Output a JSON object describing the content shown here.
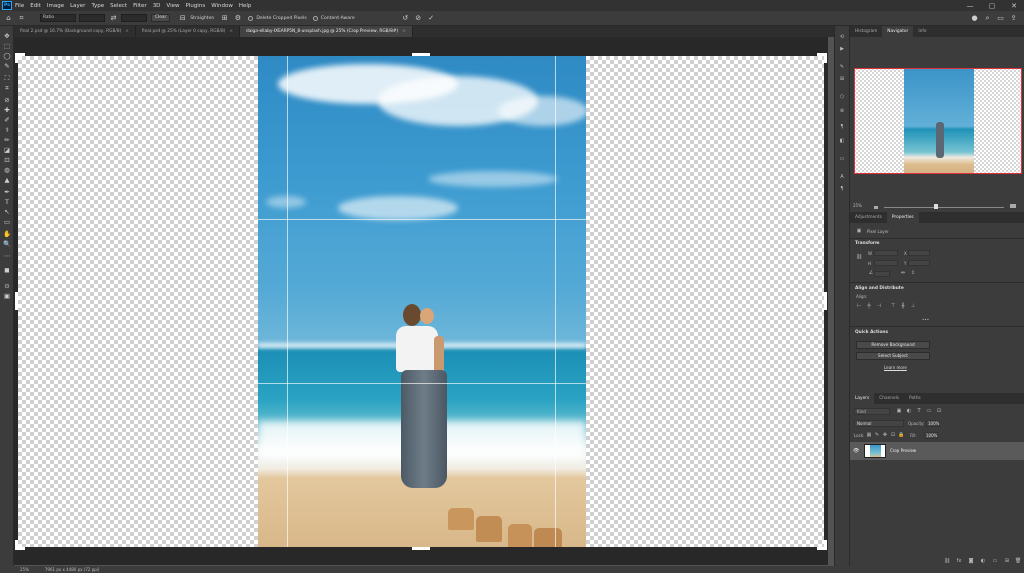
{
  "app": {
    "logo": "Ps"
  },
  "menu": [
    "File",
    "Edit",
    "Image",
    "Layer",
    "Type",
    "Select",
    "Filter",
    "3D",
    "View",
    "Plugins",
    "Window",
    "Help"
  ],
  "window_controls": {
    "minimize": "—",
    "maximize": "▢",
    "close": "✕"
  },
  "options_bar": {
    "ratio": "Ratio",
    "clear": "Clear",
    "straighten": "Straighten",
    "delete_cropped": "Delete Cropped Pixels",
    "content_aware": "Content-Aware",
    "cancel_glyph": "⊘",
    "commit_glyph": "✓",
    "reset_glyph": "↺"
  },
  "doc_tabs": [
    {
      "label": "final 2.psd @ 16.7% (Background copy, RGB/8)",
      "active": false
    },
    {
      "label": "final.psd @ 25% (Layer 0 copy, RGB/8)",
      "active": false
    },
    {
      "label": "daiga-ellaby-IXEARP5N_8-unsplash.jpg @ 25% (Crop Preview, RGB/8#)",
      "active": true
    }
  ],
  "tab_close": "×",
  "tools": [
    "✥",
    "⬚",
    "◯",
    "✎",
    "⛶",
    "⌗",
    "⊘",
    "✚",
    "✐",
    "⚕",
    "✏",
    "◪",
    "⊡",
    "◍",
    "▲",
    "✒",
    "T",
    "↖",
    "▭",
    "✋",
    "🔍",
    "⋯",
    "◼",
    "⊙",
    "▣"
  ],
  "status_bar": {
    "zoom": "25%",
    "doc_info": "7961 px x 4480 px (72 ppi)"
  },
  "navigator": {
    "tabs": [
      "Histogram",
      "Navigator",
      "Info"
    ],
    "active_tab": "Navigator",
    "zoom": "25%"
  },
  "properties": {
    "tabs": [
      "Adjustments",
      "Properties"
    ],
    "active_tab": "Properties",
    "pixel_layer": "Pixel Layer",
    "transform_title": "Transform",
    "w_label": "W",
    "h_label": "H",
    "x_label": "X",
    "y_label": "Y",
    "align_title": "Align and Distribute",
    "align_label": "Align:",
    "more": "•••",
    "quick_actions_title": "Quick Actions",
    "remove_background": "Remove Background",
    "select_subject": "Select Subject",
    "learn_more": "Learn more"
  },
  "layers": {
    "tabs": [
      "Layers",
      "Channels",
      "Paths"
    ],
    "active_tab": "Layers",
    "kind_label": "Kind",
    "blend_mode": "Normal",
    "opacity_label": "Opacity:",
    "opacity_value": "100%",
    "lock_label": "Lock:",
    "fill_label": "Fill:",
    "fill_value": "100%",
    "items": [
      {
        "name": "Crop Preview",
        "visible": true,
        "selected": true
      }
    ]
  },
  "colors": {
    "accent_red": "#e0343a",
    "ps_blue": "#31a8ff"
  }
}
